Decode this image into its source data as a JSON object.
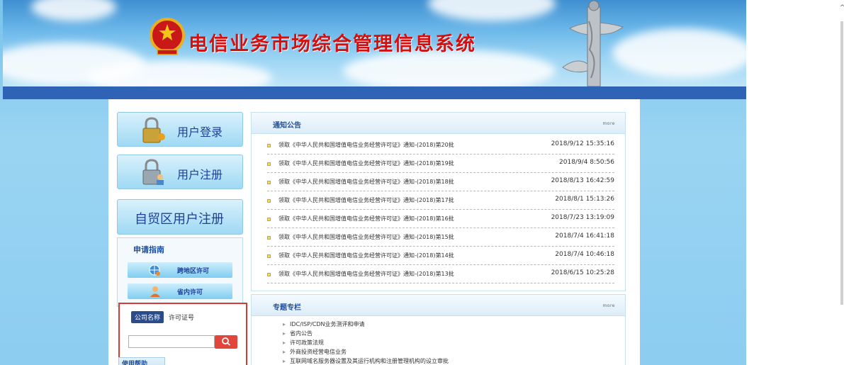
{
  "header": {
    "title": "电信业务市场综合管理信息系统"
  },
  "sidebar": {
    "login_label": "用户登录",
    "register_label": "用户注册",
    "ftz_register_label": "自贸区用户注册",
    "guide_title": "申请指南",
    "guide_items": [
      {
        "label": "跨地区许可"
      },
      {
        "label": "省内许可"
      }
    ],
    "search": {
      "tab_company": "公司名称",
      "tab_license": "许可证号",
      "input_value": "",
      "input_placeholder": ""
    },
    "help_tab": "使用帮助"
  },
  "notices": {
    "title": "通知公告",
    "more": "more",
    "items": [
      {
        "text": "领取《中华人民共和国增值电信业务经营许可证》通知-(2018)第20批",
        "date": "2018/9/12 15:35:16"
      },
      {
        "text": "领取《中华人民共和国增值电信业务经营许可证》通知-(2018)第19批",
        "date": "2018/9/4 8:50:56"
      },
      {
        "text": "领取《中华人民共和国增值电信业务经营许可证》通知-(2018)第18批",
        "date": "2018/8/13 16:42:59"
      },
      {
        "text": "领取《中华人民共和国增值电信业务经营许可证》通知-(2018)第17批",
        "date": "2018/8/1 15:13:26"
      },
      {
        "text": "领取《中华人民共和国增值电信业务经营许可证》通知-(2018)第16批",
        "date": "2018/7/23 13:19:09"
      },
      {
        "text": "领取《中华人民共和国增值电信业务经营许可证》通知-(2018)第15批",
        "date": "2018/7/4 16:41:18"
      },
      {
        "text": "领取《中华人民共和国增值电信业务经营许可证》通知-(2018)第14批",
        "date": "2018/7/4 10:46:18"
      },
      {
        "text": "领取《中华人民共和国增值电信业务经营许可证》通知-(2018)第13批",
        "date": "2018/6/15 10:25:28"
      }
    ]
  },
  "topics": {
    "title": "专题专栏",
    "more": "more",
    "items": [
      {
        "label": "IDC/ISP/CDN业务测评和申请"
      },
      {
        "label": "省内公告"
      },
      {
        "label": "许可政策法规"
      },
      {
        "label": "外商投资经营电信业务"
      },
      {
        "label": "互联网域名服务器设置及其运行机构和注册管理机构的设立审批"
      }
    ]
  },
  "colors": {
    "title_red": "#d40f10",
    "band_blue": "#2e63b6",
    "link_blue": "#1f3f9b",
    "search_red": "#e2463a"
  },
  "icons": [
    "emblem-icon",
    "huabiao-pillar-icon",
    "padlock-key-icon",
    "padlock-person-icon",
    "globe-icon",
    "person-icon",
    "search-icon",
    "bullet-icon"
  ]
}
